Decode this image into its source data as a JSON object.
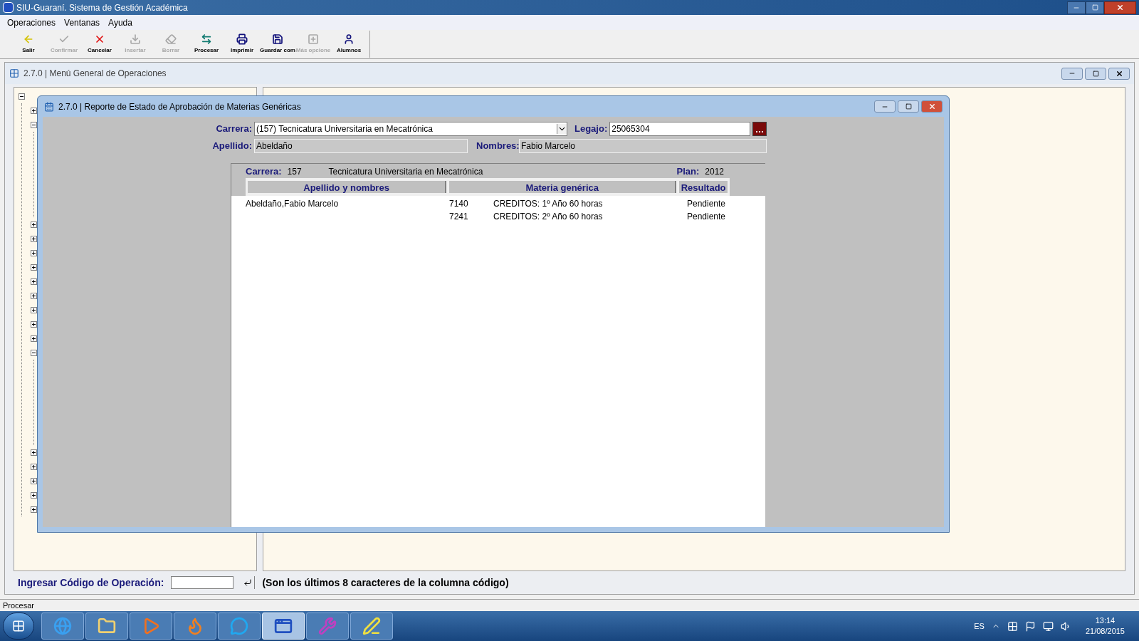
{
  "app": {
    "title": "SIU-Guaraní. Sistema de Gestión Académica"
  },
  "menu": [
    "Operaciones",
    "Ventanas",
    "Ayuda"
  ],
  "toolbar": [
    {
      "kind": "exit",
      "label": "Salir",
      "disabled": false
    },
    {
      "kind": "confirm",
      "label": "Confirmar",
      "disabled": true
    },
    {
      "kind": "cancel",
      "label": "Cancelar",
      "disabled": false
    },
    {
      "kind": "insert",
      "label": "Insertar",
      "disabled": true
    },
    {
      "kind": "delete",
      "label": "Borrar",
      "disabled": true
    },
    {
      "kind": "process",
      "label": "Procesar",
      "disabled": false
    },
    {
      "kind": "print",
      "label": "Imprimir",
      "disabled": false
    },
    {
      "kind": "save",
      "label": "Guardar com",
      "disabled": false
    },
    {
      "kind": "more",
      "label": "Más opcione",
      "disabled": true
    },
    {
      "kind": "students",
      "label": "Alumnos",
      "disabled": false
    }
  ],
  "main_window": {
    "title": "2.7.0 | Menú General de Operaciones",
    "tree": {
      "kind": "folder",
      "expanded": true,
      "children": [
        {
          "kind": "folder",
          "expanded": false
        },
        {
          "kind": "folder",
          "expanded": true
        },
        {
          "kind": "folder",
          "expanded": false
        },
        {
          "kind": "folder",
          "expanded": false
        },
        {
          "kind": "folder",
          "expanded": false
        },
        {
          "kind": "folder",
          "expanded": false
        },
        {
          "kind": "folder",
          "expanded": false
        },
        {
          "kind": "folder",
          "expanded": false
        },
        {
          "kind": "folder",
          "expanded": false
        },
        {
          "kind": "folder",
          "expanded": false
        },
        {
          "kind": "folder",
          "expanded": false
        },
        {
          "kind": "folder",
          "expanded": true
        },
        {
          "kind": "folder",
          "expanded": false
        },
        {
          "kind": "folder",
          "expanded": false
        },
        {
          "kind": "folder",
          "expanded": false
        },
        {
          "kind": "folder",
          "expanded": false
        },
        {
          "kind": "folder",
          "expanded": false
        }
      ]
    },
    "code_label": "Ingresar Código de Operación:",
    "code_hint": "(Son los últimos 8 caracteres de la columna código)"
  },
  "report_window": {
    "title": "2.7.0 | Reporte de Estado de Aprobación de Materias Genéricas",
    "carrera_label": "Carrera:",
    "carrera_value": "(157) Tecnicatura Universitaria en Mecatrónica",
    "legajo_label": "Legajo:",
    "legajo_value": "25065304",
    "apellido_label": "Apellido:",
    "apellido_value": "Abeldaño",
    "nombres_label": "Nombres:",
    "nombres_value": "Fabio Marcelo",
    "report": {
      "carrera_label": "Carrera:",
      "carrera_code": "157",
      "carrera_name": "Tecnicatura Universitaria en Mecatrónica",
      "plan_label": "Plan:",
      "plan_value": "2012",
      "columns": [
        "Apellido y nombres",
        "Materia genérica",
        "Resultado"
      ],
      "rows": [
        {
          "student": "Abeldaño,Fabio Marcelo",
          "code": "7140",
          "subject": "CREDITOS: 1º Año 60 horas",
          "result": "Pendiente"
        },
        {
          "code": "7241",
          "subject": "CREDITOS: 2º Año 60 horas",
          "result": "Pendiente"
        }
      ]
    }
  },
  "status_bar": "Procesar",
  "taskbar": {
    "apps": [
      {
        "kind": "browser",
        "selected": false
      },
      {
        "kind": "folder",
        "selected": false
      },
      {
        "kind": "media",
        "selected": false
      },
      {
        "kind": "firefox",
        "selected": false
      },
      {
        "kind": "chat",
        "selected": false
      },
      {
        "kind": "guarani",
        "selected": true
      },
      {
        "kind": "tool",
        "selected": false
      },
      {
        "kind": "editor",
        "selected": false
      }
    ],
    "language": "ES",
    "time": "13:14",
    "date": "21/08/2015"
  }
}
